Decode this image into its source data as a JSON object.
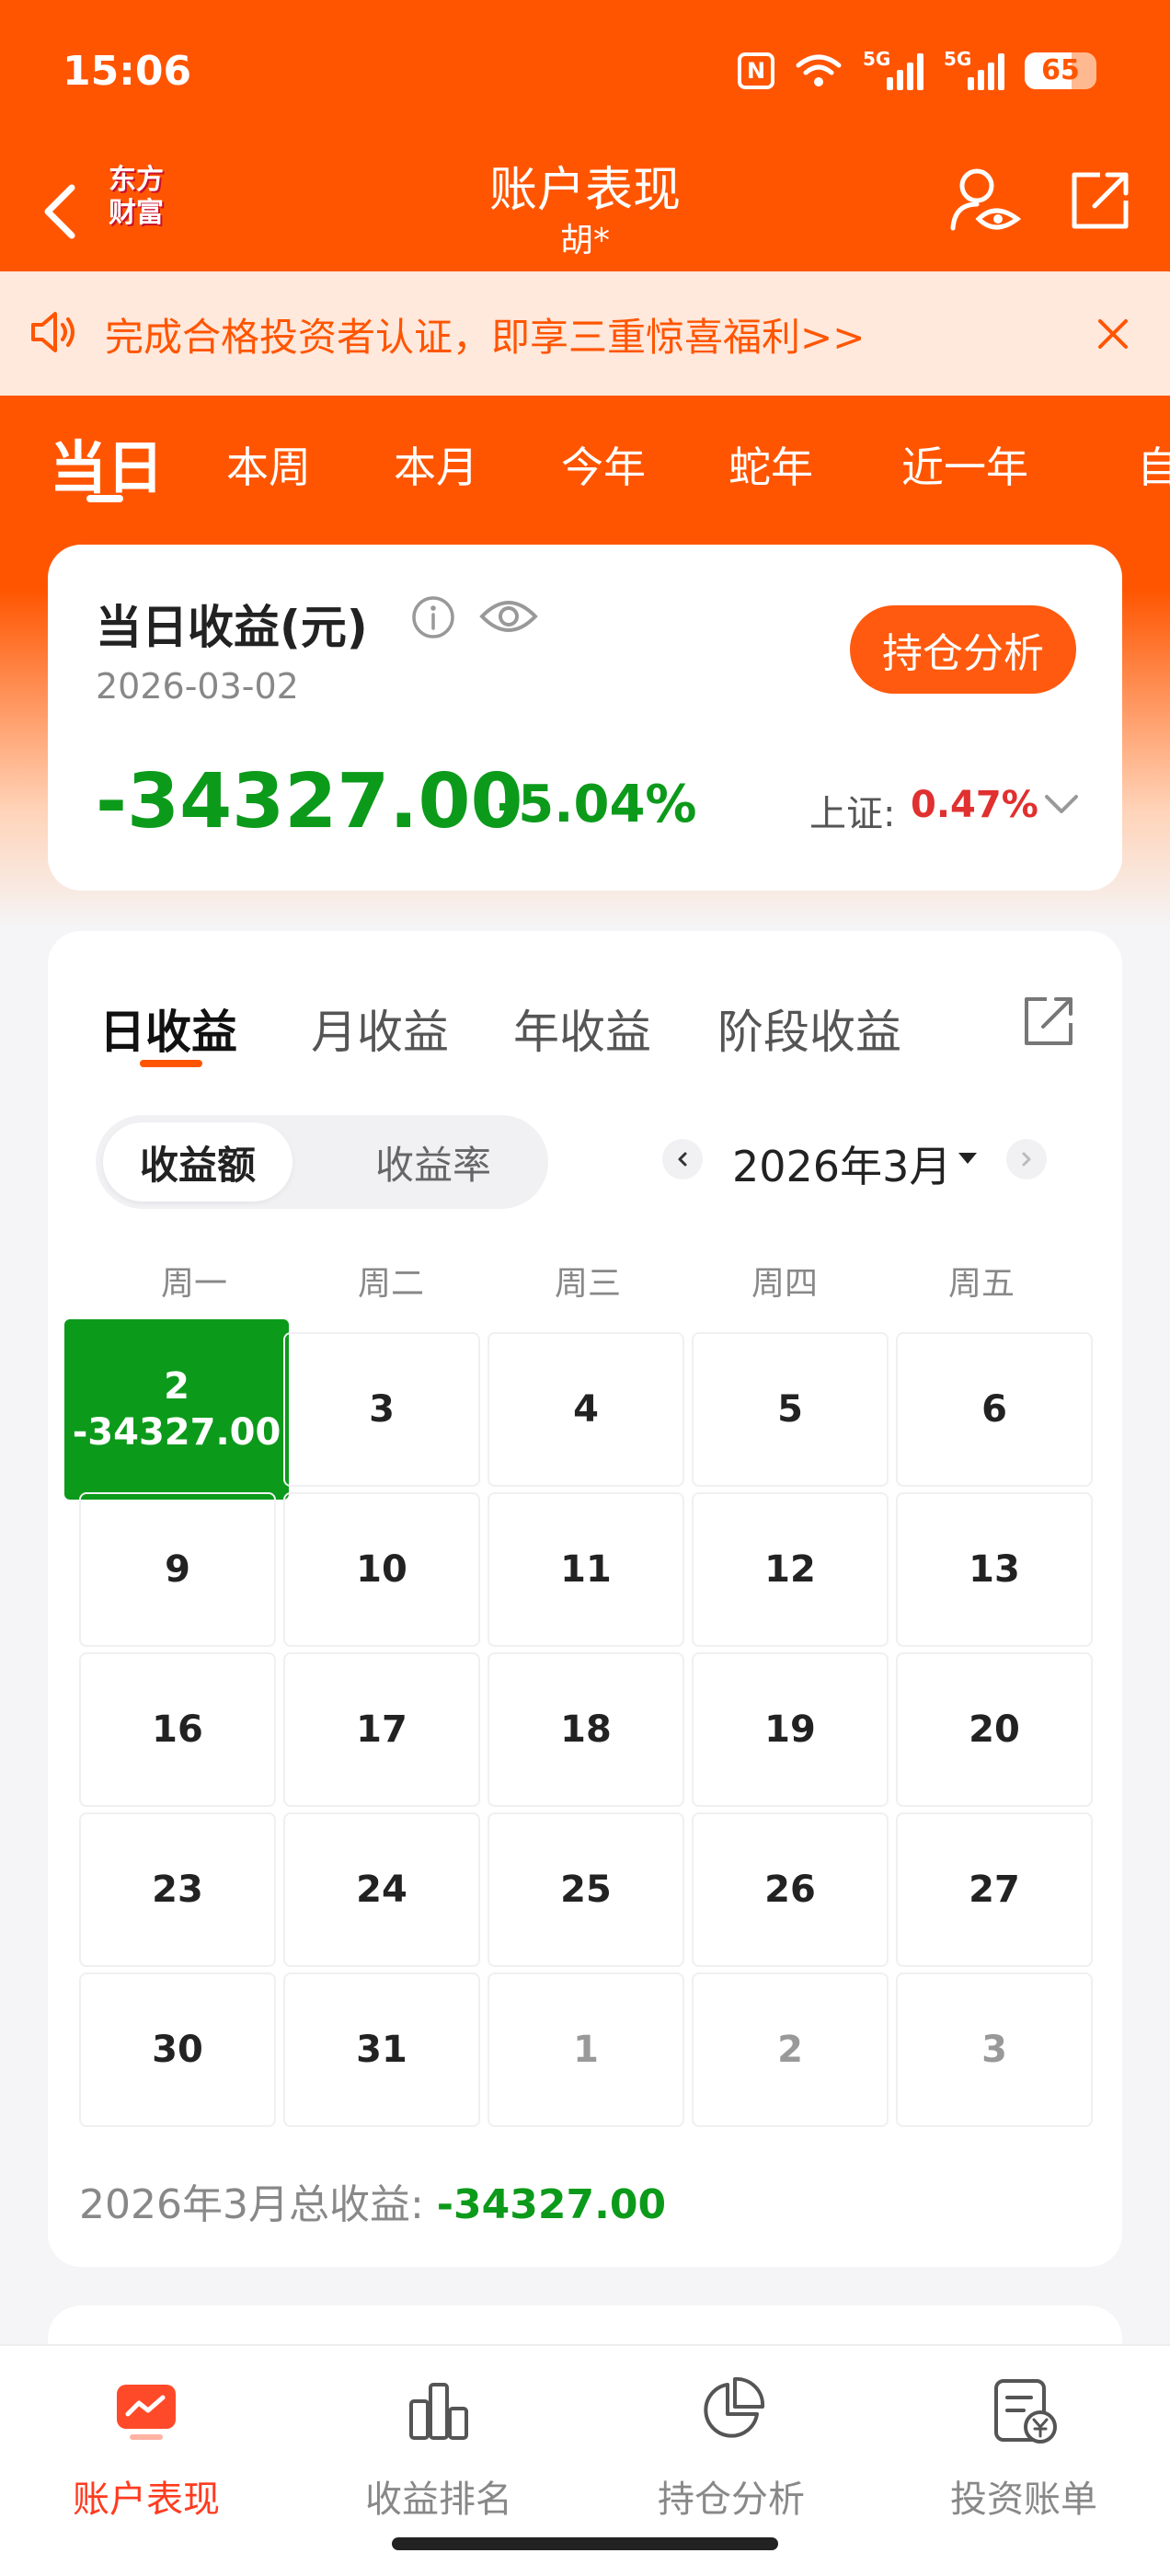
{
  "status_bar": {
    "time": "15:06",
    "signal1": "5G",
    "signal2": "5G",
    "battery": "65"
  },
  "header": {
    "logo_line1": "东方",
    "logo_line2": "财富",
    "title": "账户表现",
    "subtitle": "胡*"
  },
  "notice": {
    "text": "完成合格投资者认证，即享三重惊喜福利>>"
  },
  "period_tabs": [
    "当日",
    "本周",
    "本月",
    "今年",
    "蛇年",
    "近一年",
    "自"
  ],
  "summary": {
    "title": "当日收益(元)",
    "date": "2026-03-02",
    "holding_button": "持仓分析",
    "amount": "-34327.00",
    "percent": "-5.04%",
    "index_label": "上证:",
    "index_value": "0.47%"
  },
  "calendar": {
    "tabs": [
      "日收益",
      "月收益",
      "年收益",
      "阶段收益"
    ],
    "toggle": [
      "收益额",
      "收益率"
    ],
    "month_label": "2026年3月",
    "weekdays": [
      "周一",
      "周二",
      "周三",
      "周四",
      "周五"
    ],
    "rows": [
      [
        "2",
        "3",
        "4",
        "5",
        "6"
      ],
      [
        "9",
        "10",
        "11",
        "12",
        "13"
      ],
      [
        "16",
        "17",
        "18",
        "19",
        "20"
      ],
      [
        "23",
        "24",
        "25",
        "26",
        "27"
      ],
      [
        "30",
        "31",
        "1",
        "2",
        "3"
      ]
    ],
    "profit_day_amount": "-34327.00",
    "total_label": "2026年3月总收益: ",
    "total_value": "-34327.00"
  },
  "bottom_nav": [
    "账户表现",
    "收益排名",
    "持仓分析",
    "投资账单"
  ],
  "colors": {
    "brand": "#ff5500",
    "loss": "#0c9a1b",
    "gain": "#e0302f"
  }
}
